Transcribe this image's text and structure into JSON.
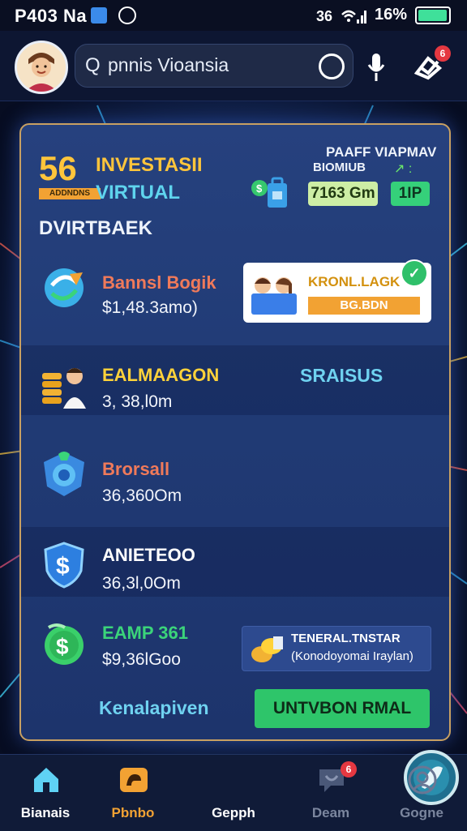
{
  "status_bar": {
    "time": "P403 Na",
    "battery": "16%"
  },
  "header": {
    "search_text": "pnnis Vioansia"
  },
  "notification_badge": "6",
  "card": {
    "big_number": "56",
    "big_number_sub": "ADDNDNS",
    "title_line1": "INVESTASII",
    "title_line2": "VIRTUAL",
    "top_right_line1": "PAAFF VIAPMAV",
    "top_right_line2": "BIOMIUB",
    "chip_value": "7163 Gm",
    "chip_green": "1IP",
    "section_title": "DVIRTBAEK",
    "rows": [
      {
        "title": "Bannsl Bogik",
        "amount": "$1,48.3amo)",
        "title_color": "#f07a5a"
      },
      {
        "title": "EALMAAGON",
        "amount": "3, 38,l0m",
        "title_color": "#ffd23a"
      },
      {
        "title": "Brorsall",
        "amount": "36,360Om",
        "title_color": "#f07a5a"
      },
      {
        "title": "ANIETEOO",
        "amount": "36,3l,0Om",
        "title_color": "#ffffff"
      },
      {
        "title": "EAMP 361",
        "amount": "$9,36lGoo",
        "title_color": "#3bd47a"
      }
    ],
    "promo": {
      "title": "KRONL.LAGK",
      "bar": "BG.BDN"
    },
    "side_label": "SRAISUS",
    "info_pill": {
      "line1": "TENERAL.TNSTAR",
      "line2": "(Konodoyomai Iraylan)"
    },
    "footer_link": "Kenalapiven",
    "cta": "UNTVBON RMAL"
  },
  "bottom_nav": [
    {
      "label": "Bianais",
      "color": "#ffffff",
      "icon": "home-icon"
    },
    {
      "label": "Pbnbo",
      "color": "#f2a233",
      "icon": "wallet-icon"
    },
    {
      "label": "Gepph",
      "color": "#ffffff",
      "icon": "globe-icon"
    },
    {
      "label": "Deam",
      "color": "#7b869e",
      "icon": "chat-icon",
      "badge": "6"
    },
    {
      "label": "Gogne",
      "color": "#7b869e",
      "icon": "profile-icon"
    }
  ],
  "colors": {
    "accent_gold": "#ffc53b",
    "accent_cyan": "#6fd2f0",
    "accent_green": "#2ec56a",
    "card_border": "#c8a062"
  }
}
